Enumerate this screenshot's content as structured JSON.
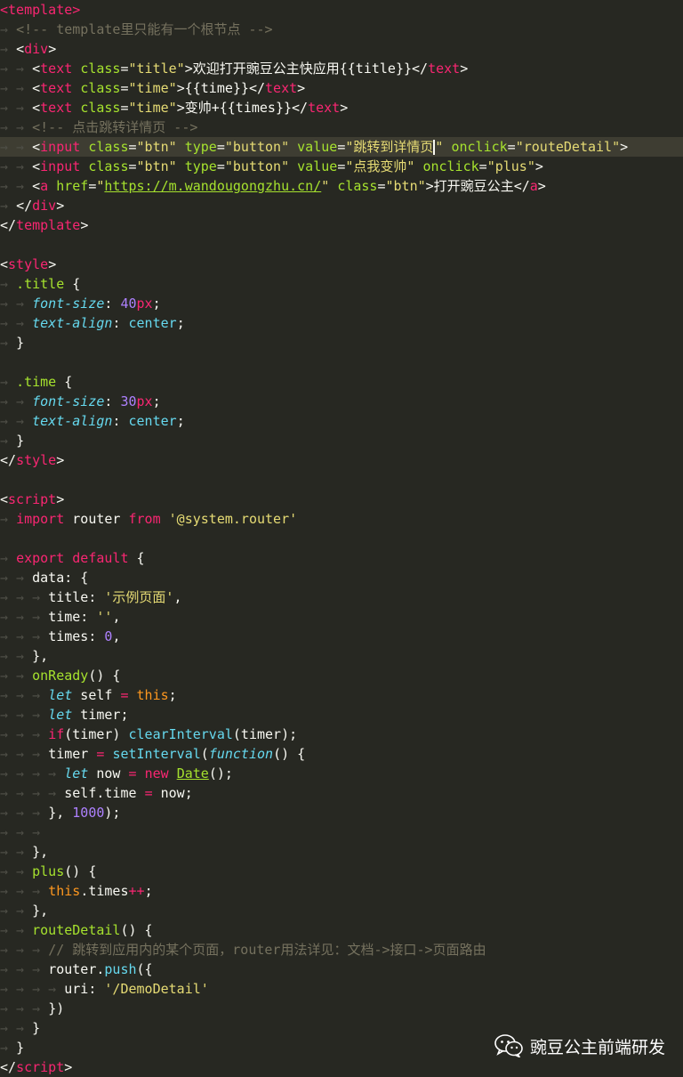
{
  "editor": {
    "language": "ux (Quick App template)",
    "current_line": 8,
    "lines": [
      [
        [
          "tg",
          "<template>"
        ]
      ],
      [
        [
          "tabs",
          "→ "
        ],
        [
          "cm",
          "<!-- template里只能有一个根节点 -->"
        ]
      ],
      [
        [
          "tabs",
          "→ "
        ],
        [
          "tx",
          "<"
        ],
        [
          "tg",
          "div"
        ],
        [
          "tx",
          ">"
        ]
      ],
      [
        [
          "tabs",
          "→ → "
        ],
        [
          "tx",
          "<"
        ],
        [
          "tg",
          "text"
        ],
        [
          "tx",
          " "
        ],
        [
          "at",
          "class"
        ],
        [
          "tx",
          "="
        ],
        [
          "st",
          "\"title\""
        ],
        [
          "tx",
          ">欢迎打开豌豆公主快应用{{title}}</"
        ],
        [
          "tg",
          "text"
        ],
        [
          "tx",
          ">"
        ]
      ],
      [
        [
          "tabs",
          "→ → "
        ],
        [
          "tx",
          "<"
        ],
        [
          "tg",
          "text"
        ],
        [
          "tx",
          " "
        ],
        [
          "at",
          "class"
        ],
        [
          "tx",
          "="
        ],
        [
          "st",
          "\"time\""
        ],
        [
          "tx",
          ">{{time}}</"
        ],
        [
          "tg",
          "text"
        ],
        [
          "tx",
          ">"
        ]
      ],
      [
        [
          "tabs",
          "→ → "
        ],
        [
          "tx",
          "<"
        ],
        [
          "tg",
          "text"
        ],
        [
          "tx",
          " "
        ],
        [
          "at",
          "class"
        ],
        [
          "tx",
          "="
        ],
        [
          "st",
          "\"time\""
        ],
        [
          "tx",
          ">变帅+{{times}}</"
        ],
        [
          "tg",
          "text"
        ],
        [
          "tx",
          ">"
        ]
      ],
      [
        [
          "tabs",
          "→ → "
        ],
        [
          "cm",
          "<!-- 点击跳转详情页 -->"
        ]
      ],
      [
        [
          "tabs",
          "→ → "
        ],
        [
          "tx",
          "<"
        ],
        [
          "tg",
          "input"
        ],
        [
          "tx",
          " "
        ],
        [
          "at",
          "class"
        ],
        [
          "tx",
          "="
        ],
        [
          "st",
          "\"btn\""
        ],
        [
          "tx",
          " "
        ],
        [
          "at",
          "type"
        ],
        [
          "tx",
          "="
        ],
        [
          "st",
          "\"button\""
        ],
        [
          "tx",
          " "
        ],
        [
          "at",
          "value"
        ],
        [
          "tx",
          "="
        ],
        [
          "st",
          "\"跳转到详情页"
        ],
        [
          "caret",
          ""
        ],
        [
          "st",
          "\""
        ],
        [
          "tx",
          " "
        ],
        [
          "at",
          "onclick"
        ],
        [
          "tx",
          "="
        ],
        [
          "st",
          "\"routeDetail\""
        ],
        [
          "tx",
          ">"
        ]
      ],
      [
        [
          "tabs",
          "→ → "
        ],
        [
          "tx",
          "<"
        ],
        [
          "tg",
          "input"
        ],
        [
          "tx",
          " "
        ],
        [
          "at",
          "class"
        ],
        [
          "tx",
          "="
        ],
        [
          "st",
          "\"btn\""
        ],
        [
          "tx",
          " "
        ],
        [
          "at",
          "type"
        ],
        [
          "tx",
          "="
        ],
        [
          "st",
          "\"button\""
        ],
        [
          "tx",
          " "
        ],
        [
          "at",
          "value"
        ],
        [
          "tx",
          "="
        ],
        [
          "st",
          "\"点我变帅\""
        ],
        [
          "tx",
          " "
        ],
        [
          "at",
          "onclick"
        ],
        [
          "tx",
          "="
        ],
        [
          "st",
          "\"plus\""
        ],
        [
          "tx",
          ">"
        ]
      ],
      [
        [
          "tabs",
          "→ → "
        ],
        [
          "tx",
          "<"
        ],
        [
          "tg",
          "a"
        ],
        [
          "tx",
          " "
        ],
        [
          "at",
          "href"
        ],
        [
          "tx",
          "="
        ],
        [
          "st",
          "\""
        ],
        [
          "cl",
          "https://m.wandougongzhu.cn/"
        ],
        [
          "st",
          "\""
        ],
        [
          "tx",
          " "
        ],
        [
          "at",
          "class"
        ],
        [
          "tx",
          "="
        ],
        [
          "st",
          "\"btn\""
        ],
        [
          "tx",
          ">打开豌豆公主</"
        ],
        [
          "tg",
          "a"
        ],
        [
          "tx",
          ">"
        ]
      ],
      [
        [
          "tabs",
          "→ "
        ],
        [
          "tx",
          "</"
        ],
        [
          "tg",
          "div"
        ],
        [
          "tx",
          ">"
        ]
      ],
      [
        [
          "tx",
          "</"
        ],
        [
          "tg",
          "template"
        ],
        [
          "tx",
          ">"
        ]
      ],
      [],
      [
        [
          "tx",
          "<"
        ],
        [
          "tg",
          "style"
        ],
        [
          "tx",
          ">"
        ]
      ],
      [
        [
          "tabs",
          "→ "
        ],
        [
          "fn",
          ".title"
        ],
        [
          "tx",
          " {"
        ]
      ],
      [
        [
          "tabs",
          "→ → "
        ],
        [
          "pr",
          "font-size"
        ],
        [
          "tx",
          ": "
        ],
        [
          "num",
          "40"
        ],
        [
          "kw",
          "px"
        ],
        [
          "tx",
          ";"
        ]
      ],
      [
        [
          "tabs",
          "→ → "
        ],
        [
          "pr",
          "text-align"
        ],
        [
          "tx",
          ": "
        ],
        [
          "vl",
          "center"
        ],
        [
          "tx",
          ";"
        ]
      ],
      [
        [
          "tabs",
          "→ "
        ],
        [
          "tx",
          "}"
        ]
      ],
      [],
      [
        [
          "tabs",
          "→ "
        ],
        [
          "fn",
          ".time"
        ],
        [
          "tx",
          " {"
        ]
      ],
      [
        [
          "tabs",
          "→ → "
        ],
        [
          "pr",
          "font-size"
        ],
        [
          "tx",
          ": "
        ],
        [
          "num",
          "30"
        ],
        [
          "kw",
          "px"
        ],
        [
          "tx",
          ";"
        ]
      ],
      [
        [
          "tabs",
          "→ → "
        ],
        [
          "pr",
          "text-align"
        ],
        [
          "tx",
          ": "
        ],
        [
          "vl",
          "center"
        ],
        [
          "tx",
          ";"
        ]
      ],
      [
        [
          "tabs",
          "→ "
        ],
        [
          "tx",
          "}"
        ]
      ],
      [
        [
          "tx",
          "</"
        ],
        [
          "tg",
          "style"
        ],
        [
          "tx",
          ">"
        ]
      ],
      [],
      [
        [
          "tx",
          "<"
        ],
        [
          "tg",
          "script"
        ],
        [
          "tx",
          ">"
        ]
      ],
      [
        [
          "tabs",
          "→ "
        ],
        [
          "kw",
          "import"
        ],
        [
          "tx",
          " router "
        ],
        [
          "kw",
          "from"
        ],
        [
          "tx",
          " "
        ],
        [
          "st",
          "'@system.router'"
        ]
      ],
      [],
      [
        [
          "tabs",
          "→ "
        ],
        [
          "kw",
          "export"
        ],
        [
          "tx",
          " "
        ],
        [
          "kw",
          "default"
        ],
        [
          "tx",
          " {"
        ]
      ],
      [
        [
          "tabs",
          "→ → "
        ],
        [
          "tx",
          "data: {"
        ]
      ],
      [
        [
          "tabs",
          "→ → → "
        ],
        [
          "tx",
          "title: "
        ],
        [
          "st",
          "'示例页面'"
        ],
        [
          "tx",
          ","
        ]
      ],
      [
        [
          "tabs",
          "→ → → "
        ],
        [
          "tx",
          "time: "
        ],
        [
          "st",
          "''"
        ],
        [
          "tx",
          ","
        ]
      ],
      [
        [
          "tabs",
          "→ → → "
        ],
        [
          "tx",
          "times: "
        ],
        [
          "num",
          "0"
        ],
        [
          "tx",
          ","
        ]
      ],
      [
        [
          "tabs",
          "→ → "
        ],
        [
          "tx",
          "},"
        ]
      ],
      [
        [
          "tabs",
          "→ → "
        ],
        [
          "fn",
          "onReady"
        ],
        [
          "tx",
          "() {"
        ]
      ],
      [
        [
          "tabs",
          "→ → → "
        ],
        [
          "kwi",
          "let"
        ],
        [
          "tx",
          " self "
        ],
        [
          "op",
          "="
        ],
        [
          "tx",
          " "
        ],
        [
          "ths",
          "this"
        ],
        [
          "tx",
          ";"
        ]
      ],
      [
        [
          "tabs",
          "→ → → "
        ],
        [
          "kwi",
          "let"
        ],
        [
          "tx",
          " timer;"
        ]
      ],
      [
        [
          "tabs",
          "→ → → "
        ],
        [
          "kw",
          "if"
        ],
        [
          "tx",
          "(timer) "
        ],
        [
          "sup",
          "clearInterval"
        ],
        [
          "tx",
          "(timer);"
        ]
      ],
      [
        [
          "tabs",
          "→ → → "
        ],
        [
          "tx",
          "timer "
        ],
        [
          "op",
          "="
        ],
        [
          "tx",
          " "
        ],
        [
          "sup",
          "setInterval"
        ],
        [
          "tx",
          "("
        ],
        [
          "kwi",
          "function"
        ],
        [
          "tx",
          "() {"
        ]
      ],
      [
        [
          "tabs",
          "→ → → → "
        ],
        [
          "kwi",
          "let"
        ],
        [
          "tx",
          " now "
        ],
        [
          "op",
          "="
        ],
        [
          "tx",
          " "
        ],
        [
          "kw",
          "new"
        ],
        [
          "tx",
          " "
        ],
        [
          "cl",
          "Date"
        ],
        [
          "tx",
          "();"
        ]
      ],
      [
        [
          "tabs",
          "→ → → → "
        ],
        [
          "tx",
          "self.time "
        ],
        [
          "op",
          "="
        ],
        [
          "tx",
          " now;"
        ]
      ],
      [
        [
          "tabs",
          "→ → → "
        ],
        [
          "tx",
          "}, "
        ],
        [
          "num",
          "1000"
        ],
        [
          "tx",
          ");"
        ]
      ],
      [
        [
          "tabs",
          "→ → → "
        ]
      ],
      [
        [
          "tabs",
          "→ → "
        ],
        [
          "tx",
          "},"
        ]
      ],
      [
        [
          "tabs",
          "→ → "
        ],
        [
          "fn",
          "plus"
        ],
        [
          "tx",
          "() {"
        ]
      ],
      [
        [
          "tabs",
          "→ → → "
        ],
        [
          "ths",
          "this"
        ],
        [
          "tx",
          ".times"
        ],
        [
          "op",
          "++"
        ],
        [
          "tx",
          ";"
        ]
      ],
      [
        [
          "tabs",
          "→ → "
        ],
        [
          "tx",
          "},"
        ]
      ],
      [
        [
          "tabs",
          "→ → "
        ],
        [
          "fn",
          "routeDetail"
        ],
        [
          "tx",
          "() {"
        ]
      ],
      [
        [
          "tabs",
          "→ → → "
        ],
        [
          "cm",
          "// 跳转到应用内的某个页面，router用法详见：文档->接口->页面路由"
        ]
      ],
      [
        [
          "tabs",
          "→ → → "
        ],
        [
          "tx",
          "router."
        ],
        [
          "sup",
          "push"
        ],
        [
          "tx",
          "({"
        ]
      ],
      [
        [
          "tabs",
          "→ → → → "
        ],
        [
          "tx",
          "uri: "
        ],
        [
          "st",
          "'/DemoDetail'"
        ]
      ],
      [
        [
          "tabs",
          "→ → → "
        ],
        [
          "tx",
          "})"
        ]
      ],
      [
        [
          "tabs",
          "→ → "
        ],
        [
          "tx",
          "}"
        ]
      ],
      [
        [
          "tabs",
          "→ "
        ],
        [
          "tx",
          "}"
        ]
      ],
      [
        [
          "tx",
          "</"
        ],
        [
          "tg",
          "script"
        ],
        [
          "tx",
          ">"
        ]
      ]
    ]
  },
  "watermark": {
    "icon": "wechat-icon",
    "text": "豌豆公主前端研发"
  },
  "colors": {
    "background": "#272822",
    "current_line": "#3e3d32",
    "tag": "#f92672",
    "attribute": "#a6e22e",
    "string": "#e6db74",
    "comment": "#75715e",
    "number": "#ae81ff",
    "support": "#66d9ef",
    "this": "#fd971f"
  }
}
